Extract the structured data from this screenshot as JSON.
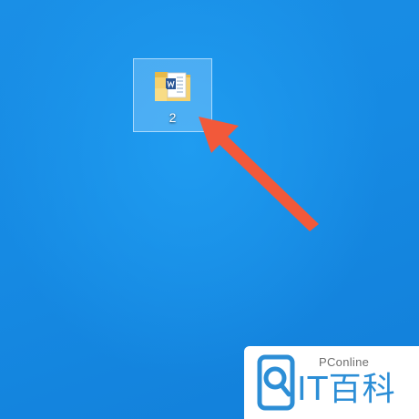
{
  "desktop": {
    "background_color": "#168ae3",
    "icons": [
      {
        "label": "2",
        "icon": "folder-with-word-document-icon",
        "selected": true
      }
    ]
  },
  "annotation": {
    "icon": "pointer-arrow-icon",
    "color": "#f2593a"
  },
  "watermark": {
    "brand_small": "PConline",
    "brand_large": "IT百科",
    "accent_color": "#2c8ed6"
  }
}
